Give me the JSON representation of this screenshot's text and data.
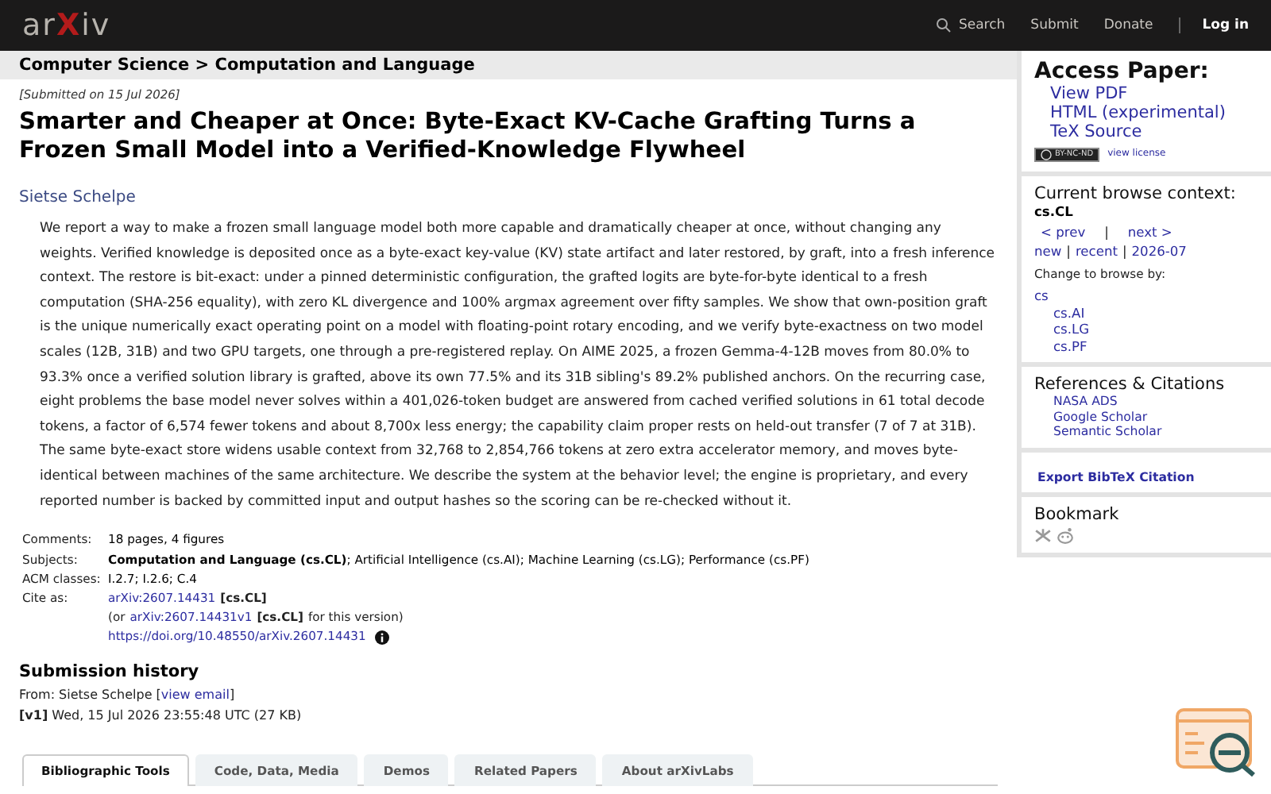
{
  "header": {
    "logo": [
      {
        "text": "ar",
        "accent": false
      },
      {
        "text": "X",
        "accent": true
      },
      {
        "text": "iv",
        "accent": false
      }
    ],
    "nav": [
      {
        "label": "Search",
        "kind": "search"
      },
      {
        "label": "Submit",
        "kind": "link"
      },
      {
        "label": "Donate",
        "kind": "link"
      },
      {
        "label": "Log in",
        "kind": "login"
      }
    ]
  },
  "breadcrumb": "Computer Science > Computation and Language",
  "submitted": "[Submitted on 15 Jul 2026]",
  "title": "Smarter and Cheaper at Once: Byte-Exact KV-Cache Grafting Turns a Frozen Small Model into a Verified-Knowledge Flywheel",
  "author": "Sietse Schelpe",
  "abstract": "We report a way to make a frozen small language model both more capable and dramatically cheaper at once, without changing any weights. Verified knowledge is deposited once as a byte-exact key-value (KV) state artifact and later restored, by graft, into a fresh inference context. The restore is bit-exact: under a pinned deterministic configuration, the grafted logits are byte-for-byte identical to a fresh computation (SHA-256 equality), with zero KL divergence and 100% argmax agreement over fifty samples. We show that own-position graft is the unique numerically exact operating point on a model with floating-point rotary encoding, and we verify byte-exactness on two model scales (12B, 31B) and two GPU targets, one through a pre-registered replay. On AIME 2025, a frozen Gemma-4-12B moves from 80.0% to 93.3% once a verified solution library is grafted, above its own 77.5% and its 31B sibling's 89.2% published anchors. On the recurring case, eight problems the base model never solves within a 401,026-token budget are answered from cached verified solutions in 61 total decode tokens, a factor of 6,574 fewer tokens and about 8,700x less energy; the capability claim proper rests on held-out transfer (7 of 7 at 31B). The same byte-exact store widens usable context from 32,768 to 2,854,766 tokens at zero extra accelerator memory, and moves byte-identical between machines of the same architecture. We describe the system at the behavior level; the engine is proprietary, and every reported number is backed by committed input and output hashes so the scoring can be re-checked without it.",
  "metadata": [
    {
      "label": "Comments:",
      "value": "18 pages, 4 figures"
    },
    {
      "label": "Subjects:",
      "value": "**Computation and Language (cs.CL)**; Artificial Intelligence (cs.AI); Machine Learning (cs.LG); Performance (cs.PF)"
    },
    {
      "label": "ACM classes:",
      "value": "I.2.7; I.2.6; C.4"
    }
  ],
  "cite": {
    "label": "Cite as:",
    "lines": [
      {
        "link": "arXiv:2607.14431",
        "tag": "[cs.CL]",
        "info": false
      },
      {
        "prefix": "(or",
        "link": "arXiv:2607.14431v1",
        "tag": "[cs.CL]",
        "suffix": "for this version)",
        "info": false
      },
      {
        "link": "https://doi.org/10.48550/arXiv.2607.14431",
        "info": true
      }
    ]
  },
  "history": {
    "title": "Submission history",
    "from_prefix": "From: Sietse Schelpe [",
    "from_link": "view email",
    "from_suffix": "]",
    "versions": [
      "**[v1]** Wed, 15 Jul 2026 23:55:48 UTC (27 KB)"
    ]
  },
  "tabs": [
    {
      "label": "Bibliographic Tools",
      "selected": true
    },
    {
      "label": "Code, Data, Media",
      "selected": false
    },
    {
      "label": "Demos",
      "selected": false
    },
    {
      "label": "Related Papers",
      "selected": false
    },
    {
      "label": "About arXivLabs",
      "selected": false
    }
  ],
  "sidebar": {
    "access": {
      "title": "Access Paper:",
      "links": [
        "View PDF",
        "HTML (experimental)",
        "TeX Source"
      ],
      "license_badge": "BY-NC-ND",
      "license_link": "view license"
    },
    "browse": {
      "title": "Current browse context:",
      "context": "cs.CL",
      "prev": "< prev",
      "sep": "|",
      "next": "next >",
      "periods": [
        "new",
        "recent",
        "2026-07"
      ],
      "change_label": "Change to browse by:",
      "categories": [
        {
          "label": "cs",
          "children": [
            {
              "label": "cs.AI"
            },
            {
              "label": "cs.LG"
            },
            {
              "label": "cs.PF"
            }
          ]
        }
      ]
    },
    "refs": {
      "title": "References & Citations",
      "links": [
        "NASA ADS",
        "Google Scholar",
        "Semantic Scholar"
      ]
    },
    "export": "Export BibTeX Citation",
    "bookmark": {
      "title": "Bookmark"
    }
  }
}
